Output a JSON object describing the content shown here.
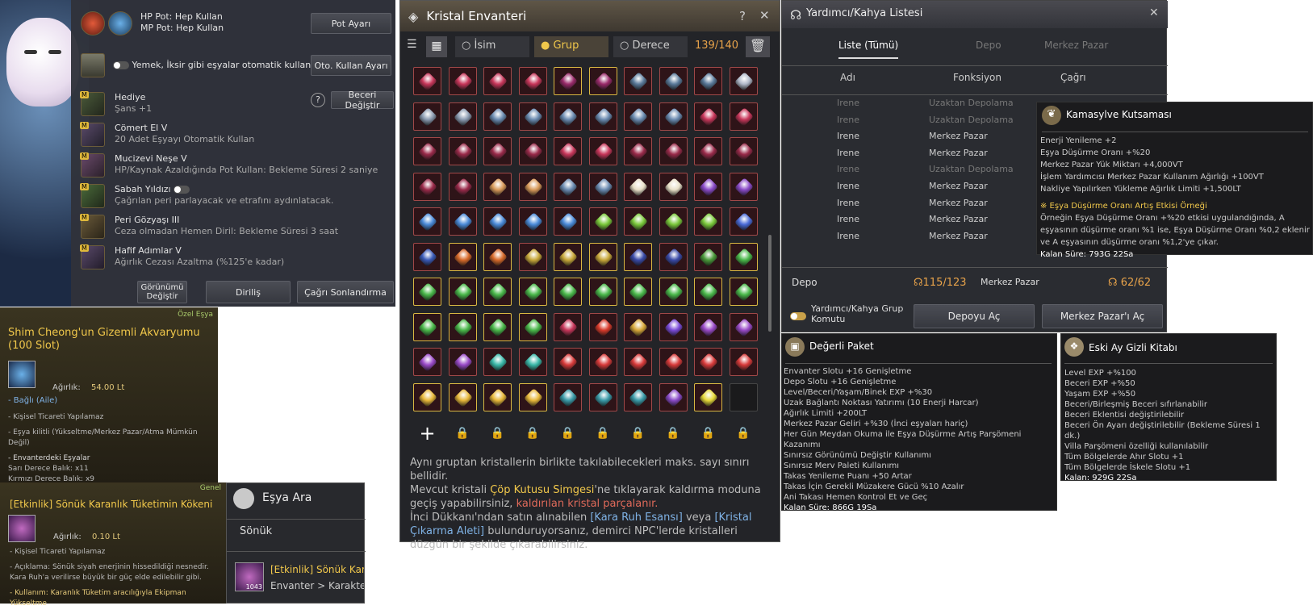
{
  "pet": {
    "hp_pot": "HP Pot: Hep Kullan",
    "mp_pot": "MP Pot: Hep Kullan",
    "pot_ayari": "Pot Ayarı",
    "auto_use_text": "Yemek, İksir gibi eşyalar otomatik kullanılır.",
    "oto_kullan": "Oto. Kullan Ayarı",
    "beceri_degistir": "Beceri Değiştir",
    "skills": [
      {
        "name": "Hediye",
        "desc": "Şans +1"
      },
      {
        "name": "Cömert El V",
        "desc": "20 Adet Eşyayı Otomatik Kullan"
      },
      {
        "name": "Mucizevi Neşe V",
        "desc": "HP/Kaynak Azaldığında Pot Kullan: Bekleme Süresi 2 saniye"
      },
      {
        "name": "Sabah Yıldızı",
        "desc": "Çağrılan peri parlayacak ve etrafını aydınlatacak."
      },
      {
        "name": "Peri Gözyaşı III",
        "desc": "Ceza olmadan Hemen Diril: Bekleme Süresi 3 saat"
      },
      {
        "name": "Hafif Adımlar V",
        "desc": "Ağırlık Cezası Azaltma (%125'e kadar)"
      }
    ],
    "gorunum": "Görünümü Değiştir",
    "dirilis": "Diriliş",
    "cagri_son": "Çağrı Sonlandırma"
  },
  "shim": {
    "tag": "Özel Eşya",
    "title": "Shim Cheong'un Gizemli Akvaryumu (100 Slot)",
    "weight_label": "Ağırlık:",
    "weight": "54.00 Lt",
    "bound": "- Bağlı (Aile)",
    "l1": "- Kişisel Ticareti Yapılamaz",
    "l2": "- Eşya kilitli (Yükseltme/Merkez Pazar/Atma Mümkün Değil)",
    "l3": "- Envanterdeki Eşyalar",
    "l4": "Sarı Derece Balık: x11",
    "l5": "Kırmızı Derece Balık: x9"
  },
  "etk": {
    "tag": "Genel",
    "title": "[Etkinlik] Sönük Karanlık Tüketimin Kökeni",
    "weight_label": "Ağırlık:",
    "weight": "0.10 Lt",
    "l1": "- Kişisel Ticareti Yapılamaz",
    "l2": "- Açıklama: Sönük siyah enerjinin hissedildiği nesnedir. Kara Ruh'a verilirse büyük bir güç elde edilebilir gibi.",
    "l3": "- Kullanım: Karanlık Tüketim aracılığıyla Ekipman Yükseltme"
  },
  "esya": {
    "title": "Eşya Ara",
    "query": "Sönük",
    "result": "[Etkinlik] Sönük Kar",
    "path": "Envanter > Karakter",
    "count": "1043"
  },
  "kristal": {
    "title": "Kristal Envanteri",
    "tab_isim": "İsim",
    "tab_grup": "Grup",
    "tab_derece": "Derece",
    "count": "139/140",
    "foot1": "Aynı gruptan kristallerin birlikte takılabilecekleri maks. sayı sınırı bellidir.",
    "foot2a": "Mevcut kristali ",
    "foot2b": "Çöp Kutusu Simgesi",
    "foot2c": "'ne tıklayarak kaldırma moduna geçiş yapabilirsiniz, ",
    "foot2d": "kaldırılan kristal parçalanır.",
    "foot3a": "İnci Dükkanı'ndan satın alınabilen ",
    "foot3b": "[Kara Ruh Esansı]",
    "foot3c": " veya ",
    "foot3d": "[Kristal Çıkarma Aleti]",
    "foot3e": " bulunduruyorsanız, demirci NPC'lerde kristalleri düzgün bir şekilde çıkarabilirsiniz."
  },
  "helper": {
    "title": "Yardımcı/Kahya Listesi",
    "tab1": "Liste (Tümü)",
    "tab2": "Depo",
    "tab3": "Merkez Pazar",
    "col1": "Adı",
    "col2": "Fonksiyon",
    "col3": "Çağrı",
    "rows": [
      {
        "name": "Irene",
        "fn": "Uzaktan Depolama"
      },
      {
        "name": "Irene",
        "fn": "Uzaktan Depolama"
      },
      {
        "name": "Irene",
        "fn": "Merkez Pazar"
      },
      {
        "name": "Irene",
        "fn": "Merkez Pazar"
      },
      {
        "name": "Irene",
        "fn": "Uzaktan Depolama"
      },
      {
        "name": "Irene",
        "fn": "Merkez Pazar"
      },
      {
        "name": "Irene",
        "fn": "Merkez Pazar"
      },
      {
        "name": "Irene",
        "fn": "Merkez Pazar"
      },
      {
        "name": "Irene",
        "fn": "Merkez Pazar"
      }
    ],
    "depo_label": "Depo",
    "depo_count": "115/123",
    "mp_label": "Merkez Pazar",
    "mp_count": "62/62",
    "group_cmd": "Yardımcı/Kahya Grup Komutu",
    "depo_ac": "Depoyu Aç",
    "mp_ac": "Merkez Pazar'ı Aç"
  },
  "kama": {
    "title": "Kamasylve Kutsaması",
    "lines": [
      "Enerji Yenileme +2",
      "Eşya Düşürme Oranı +%20",
      "Merkez Pazar Yük Miktarı +4,000VT",
      "İşlem Yardımcısı Merkez Pazar Kullanım Ağırlığı +100VT",
      "Nakliye Yapılırken Yükleme Ağırlık Limiti +1,500LT"
    ],
    "ex_title": "※ Eşya Düşürme Oranı Artış Etkisi Örneği",
    "ex_body": "Örneğin Eşya Düşürme Oranı +%20 etkisi uygulandığında, A eşyasının düşürme oranı %1 ise, Eşya Düşürme Oranı %0,2 eklenir ve A eşyasının düşürme oranı %1,2'ye çıkar.",
    "remain": "Kalan Süre: 793G 22Sa"
  },
  "degerli": {
    "title": "Değerli Paket",
    "lines": [
      "Envanter Slotu +16 Genişletme",
      "Depo Slotu +16 Genişletme",
      "Level/Beceri/Yaşam/Binek EXP +%30",
      "Uzak Bağlantı Noktası Yatırımı (10 Enerji Harcar)",
      "Ağırlık Limiti +200LT",
      "Merkez Pazar Geliri +%30 (İnci eşyaları hariç)",
      "Her Gün Meydan Okuma ile Eşya Düşürme Artış Parşömeni Kazanımı",
      "Sınırsız Görünümü Değiştir Kullanımı",
      "Sınırsız Merv Paleti Kullanımı",
      "Takas Yenileme Puanı +50 Artar",
      "Takas İçin Gerekli Müzakere Gücü %10 Azalır",
      "Ani Takası Hemen Kontrol Et ve Geç"
    ],
    "remain": "Kalan Süre: 866G 19Sa"
  },
  "eski": {
    "title": "Eski Ay Gizli Kitabı",
    "lines": [
      "Level EXP +%100",
      "Beceri EXP +%50",
      "Yaşam EXP +%50",
      "Beceri/Birleşmiş Beceri sıfırlanabilir",
      "Beceri Eklentisi değiştirilebilir",
      "Beceri Ön Ayarı değiştirilebilir (Bekleme Süresi 1 dk.)",
      "Villa Parşömeni özelliği kullanılabilir",
      "Tüm Bölgelerde Ahır Slotu +1",
      "Tüm Bölgelerde İskele Slotu +1"
    ],
    "remain": "Kalan: 929G 22Sa"
  },
  "colors": {
    "gold": "#e2c77a",
    "frame_red": "#a04848",
    "frame_yellow": "#d9b842",
    "accent": "#e8a34a"
  }
}
